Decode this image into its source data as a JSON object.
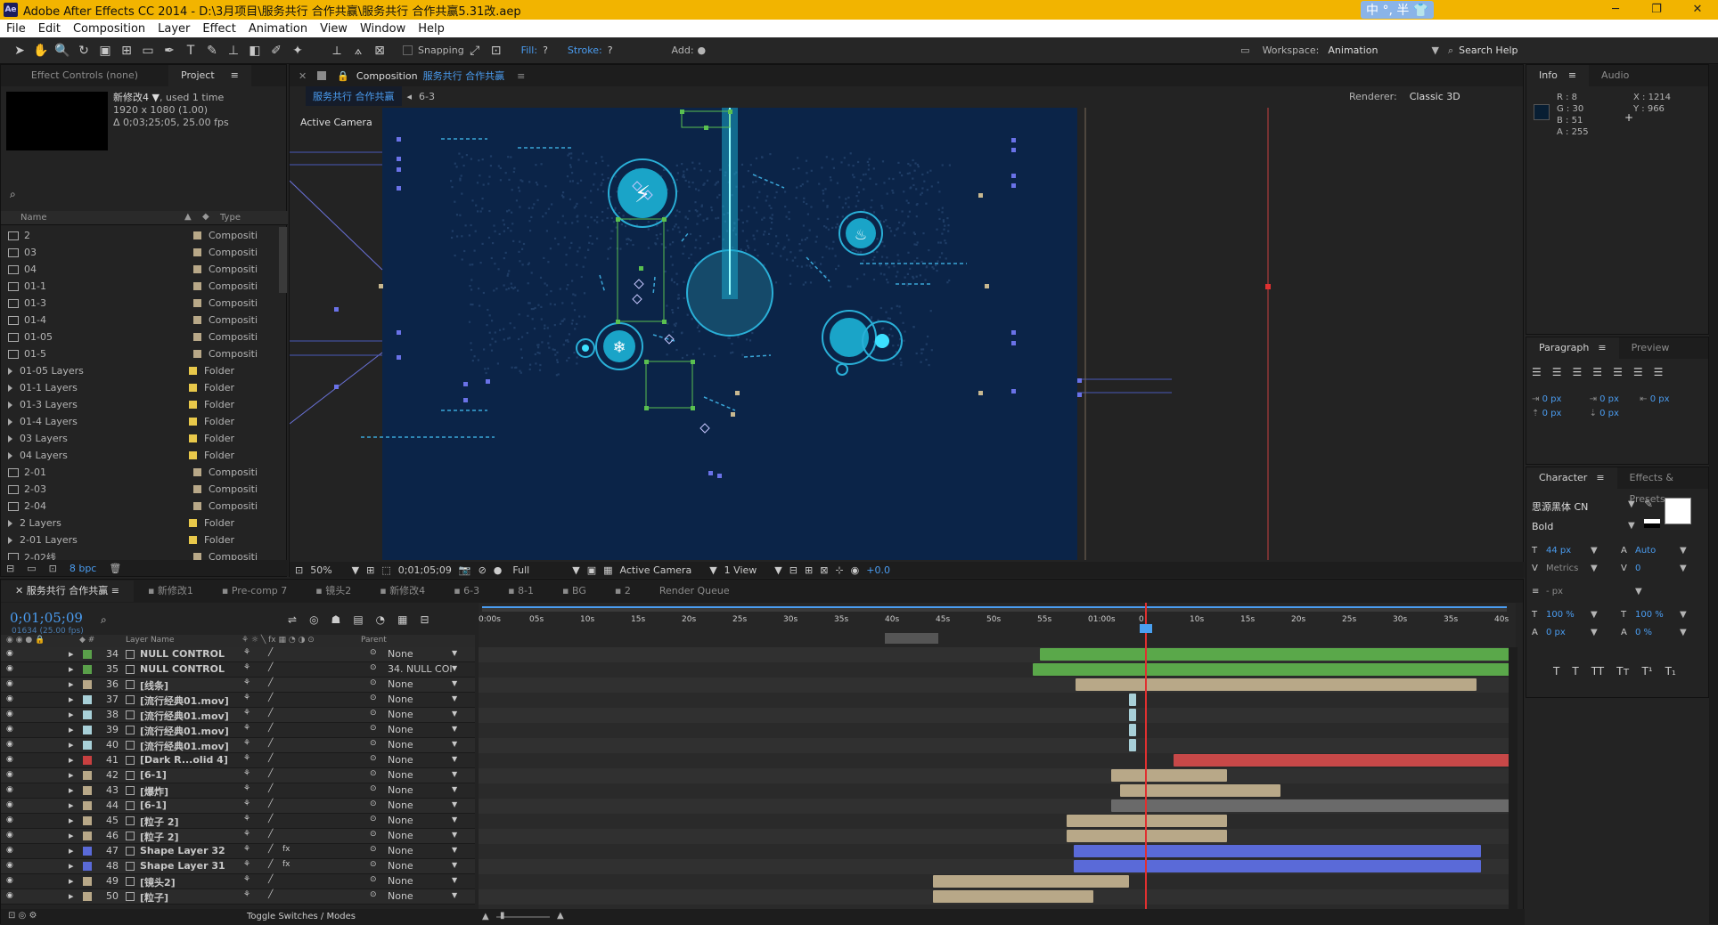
{
  "titlebar": {
    "title": "Adobe After Effects CC 2014 - D:\\3月项目\\服务共行 合作共赢\\服务共行 合作共赢5.31改.aep",
    "ime": "中 °, 半 👕",
    "minimize": "─",
    "restore": "❐",
    "close": "✕"
  },
  "menu": [
    "File",
    "Edit",
    "Composition",
    "Layer",
    "Effect",
    "Animation",
    "View",
    "Window",
    "Help"
  ],
  "toolbar": {
    "snapping": "Snapping",
    "fill": "Fill:",
    "fill_val": "?",
    "stroke": "Stroke:",
    "stroke_val": "?",
    "add": "Add:",
    "workspace_label": "Workspace:",
    "workspace": "Animation",
    "search": "Search Help"
  },
  "left": {
    "tab_effect": "Effect Controls (none)",
    "tab_project": "Project",
    "item_name": "新修改4 ▼",
    "item_used": ", used 1 time",
    "item_size": "1920 x 1080 (1.00)",
    "item_dur": "Δ 0;03;25;05, 25.00 fps",
    "col_name": "Name",
    "col_type": "Type",
    "items": [
      {
        "name": "2",
        "type": "Compositi",
        "color": "#b8a888",
        "kind": "comp"
      },
      {
        "name": "03",
        "type": "Compositi",
        "color": "#b8a888",
        "kind": "comp"
      },
      {
        "name": "04",
        "type": "Compositi",
        "color": "#b8a888",
        "kind": "comp"
      },
      {
        "name": "01-1",
        "type": "Compositi",
        "color": "#b8a888",
        "kind": "comp"
      },
      {
        "name": "01-3",
        "type": "Compositi",
        "color": "#b8a888",
        "kind": "comp"
      },
      {
        "name": "01-4",
        "type": "Compositi",
        "color": "#b8a888",
        "kind": "comp"
      },
      {
        "name": "01-05",
        "type": "Compositi",
        "color": "#b8a888",
        "kind": "comp"
      },
      {
        "name": "01-5",
        "type": "Compositi",
        "color": "#b8a888",
        "kind": "comp"
      },
      {
        "name": "01-05 Layers",
        "type": "Folder",
        "color": "#e8c84a",
        "kind": "folder"
      },
      {
        "name": "01-1 Layers",
        "type": "Folder",
        "color": "#e8c84a",
        "kind": "folder"
      },
      {
        "name": "01-3 Layers",
        "type": "Folder",
        "color": "#e8c84a",
        "kind": "folder"
      },
      {
        "name": "01-4 Layers",
        "type": "Folder",
        "color": "#e8c84a",
        "kind": "folder"
      },
      {
        "name": "03 Layers",
        "type": "Folder",
        "color": "#e8c84a",
        "kind": "folder"
      },
      {
        "name": "04 Layers",
        "type": "Folder",
        "color": "#e8c84a",
        "kind": "folder"
      },
      {
        "name": "2-01",
        "type": "Compositi",
        "color": "#b8a888",
        "kind": "comp"
      },
      {
        "name": "2-03",
        "type": "Compositi",
        "color": "#b8a888",
        "kind": "comp"
      },
      {
        "name": "2-04",
        "type": "Compositi",
        "color": "#b8a888",
        "kind": "comp"
      },
      {
        "name": "2 Layers",
        "type": "Folder",
        "color": "#e8c84a",
        "kind": "folder"
      },
      {
        "name": "2-01 Layers",
        "type": "Folder",
        "color": "#e8c84a",
        "kind": "folder"
      },
      {
        "name": "2-02线",
        "type": "Compositi",
        "color": "#b8a888",
        "kind": "comp"
      }
    ],
    "bpc": "8 bpc"
  },
  "comp": {
    "title": "Composition",
    "name": "服务共行 合作共赢",
    "crumb": "服务共行 合作共赢",
    "crumb2": "6-3",
    "renderer_label": "Renderer:",
    "renderer": "Classic 3D",
    "camera": "Active Camera",
    "zoom": "50%",
    "time": "0;01;05;09",
    "res": "Full",
    "view_cam": "Active Camera",
    "views": "1 View",
    "exposure": "+0.0"
  },
  "info": {
    "tab": "Info",
    "tab2": "Audio",
    "r": "R : 8",
    "g": "G : 30",
    "b": "B : 51",
    "a": "A : 255",
    "x": "X : 1214",
    "y": "Y : 966"
  },
  "paragraph": {
    "tab": "Paragraph",
    "tab2": "Preview",
    "v1": "0 px",
    "v2": "0 px",
    "v3": "0 px",
    "v4": "0 px",
    "v5": "0 px"
  },
  "character": {
    "tab": "Character",
    "tab2": "Effects & Presets",
    "font": "思源黑体 CN",
    "style": "Bold",
    "size": "44 px",
    "leading": "Auto",
    "metrics": "Metrics",
    "tracking": "0",
    "stroke": "- px",
    "vscale": "100 %",
    "hscale": "100 %",
    "baseline": "0 px",
    "tsume": "0 %"
  },
  "timeline": {
    "tabs": [
      "服务共行 合作共赢",
      "新修改1",
      "Pre-comp 7",
      "镜头2",
      "新修改4",
      "6-3",
      "8-1",
      "BG",
      "2",
      "Render Queue"
    ],
    "time": "0;01;05;09",
    "frames": "01634 (25.00 fps)",
    "col_layer": "Layer Name",
    "col_parent": "Parent",
    "ruler": [
      "0:00s",
      "05s",
      "10s",
      "15s",
      "20s",
      "25s",
      "30s",
      "35s",
      "40s",
      "45s",
      "50s",
      "55s",
      "01:00s",
      "0",
      "10s",
      "15s",
      "20s",
      "25s",
      "30s",
      "35s",
      "40s"
    ],
    "toggle": "Toggle Switches / Modes",
    "layers": [
      {
        "num": "34",
        "name": "NULL CONTROL",
        "label": "#5aa04a",
        "parent": "None",
        "fx": ""
      },
      {
        "num": "35",
        "name": "NULL CONTROL",
        "label": "#5aa04a",
        "parent": "34. NULL COI",
        "fx": ""
      },
      {
        "num": "36",
        "name": "[线条]",
        "label": "#b8a888",
        "parent": "None",
        "fx": ""
      },
      {
        "num": "37",
        "name": "[流行经典01.mov]",
        "label": "#a8d0d8",
        "parent": "None",
        "fx": ""
      },
      {
        "num": "38",
        "name": "[流行经典01.mov]",
        "label": "#a8d0d8",
        "parent": "None",
        "fx": ""
      },
      {
        "num": "39",
        "name": "[流行经典01.mov]",
        "label": "#a8d0d8",
        "parent": "None",
        "fx": ""
      },
      {
        "num": "40",
        "name": "[流行经典01.mov]",
        "label": "#a8d0d8",
        "parent": "None",
        "fx": ""
      },
      {
        "num": "41",
        "name": "[Dark R...olid 4]",
        "label": "#c84040",
        "parent": "None",
        "fx": ""
      },
      {
        "num": "42",
        "name": "[6-1]",
        "label": "#b8a888",
        "parent": "None",
        "fx": ""
      },
      {
        "num": "43",
        "name": "[爆炸]",
        "label": "#b8a888",
        "parent": "None",
        "fx": ""
      },
      {
        "num": "44",
        "name": "[6-1]",
        "label": "#b8a888",
        "parent": "None",
        "fx": ""
      },
      {
        "num": "45",
        "name": "[粒子 2]",
        "label": "#b8a888",
        "parent": "None",
        "fx": ""
      },
      {
        "num": "46",
        "name": "[粒子 2]",
        "label": "#b8a888",
        "parent": "None",
        "fx": ""
      },
      {
        "num": "47",
        "name": "Shape Layer 32",
        "label": "#5a6ad8",
        "parent": "None",
        "fx": "fx"
      },
      {
        "num": "48",
        "name": "Shape Layer 31",
        "label": "#5a6ad8",
        "parent": "None",
        "fx": "fx"
      },
      {
        "num": "49",
        "name": "[镜头2]",
        "label": "#b8a888",
        "parent": "None",
        "fx": ""
      },
      {
        "num": "50",
        "name": "[粒子]",
        "label": "#b8a888",
        "parent": "None",
        "fx": ""
      }
    ]
  }
}
